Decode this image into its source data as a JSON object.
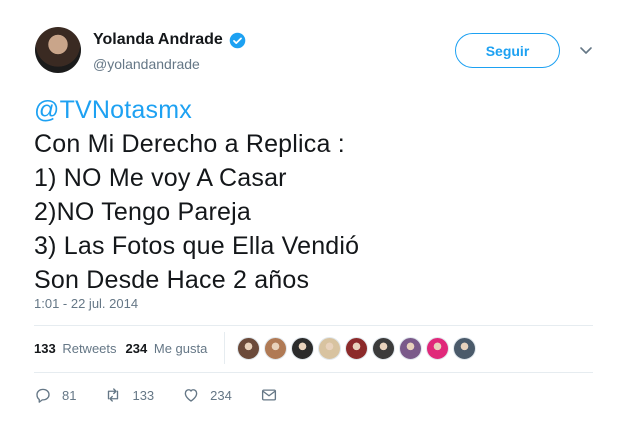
{
  "author": {
    "display_name": "Yolanda Andrade",
    "handle": "@yolandandrade",
    "verified": true
  },
  "follow_label": "Seguir",
  "tweet": {
    "mention": "@TVNotasmx",
    "lines": [
      "Con Mi Derecho a Replica :",
      "1) NO Me voy A Casar",
      "2)NO Tengo Pareja",
      "3) Las Fotos que Ella Vendió",
      "Son Desde Hace 2 años"
    ],
    "timestamp": "1:01 - 22 jul. 2014"
  },
  "stats": {
    "retweets_count": "133",
    "retweets_label": "Retweets",
    "likes_count": "234",
    "likes_label": "Me gusta"
  },
  "liker_avatars": [
    "#6b4a3a",
    "#b07a55",
    "#2b2b2b",
    "#d8c3a0",
    "#8c2a2a",
    "#3b3b3b",
    "#7a5a8a",
    "#e0287a",
    "#4a5a6a"
  ],
  "actions": {
    "replies": "81",
    "retweets": "133",
    "likes": "234"
  },
  "colors": {
    "accent": "#1da1f2",
    "secondary_text": "#657786"
  }
}
